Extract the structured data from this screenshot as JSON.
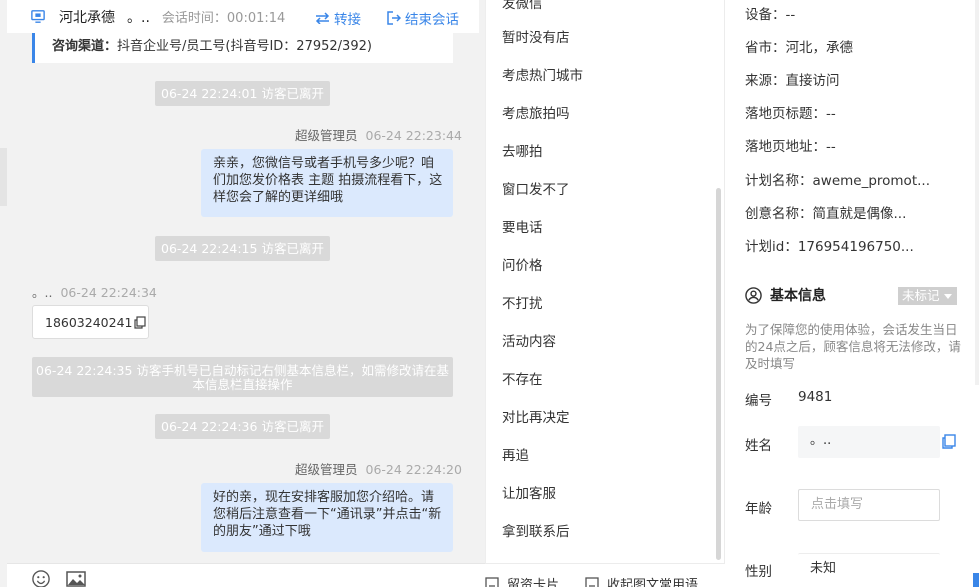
{
  "header": {
    "location": "河北承德",
    "visitor_name": "。..",
    "session_time": "会话时间：00:01:14",
    "transfer_label": "转接",
    "end_session_label": "结束会话"
  },
  "consult_channel": {
    "label": "咨询渠道：",
    "value": "抖音企业号/员工号(抖音号ID：27952/392)"
  },
  "messages": {
    "sys1": "06-24 22:24:01 访客已离开",
    "admin1_name": "超级管理员",
    "admin1_time": "06-24 22:23:44",
    "admin1_text": "亲亲，您微信号或者手机号多少呢？咱们加您发价格表 主题 拍摄流程看下，这样您会了解的更详细哦",
    "sys2": "06-24 22:24:15 访客已离开",
    "visitor_name": "。..",
    "visitor_time": "06-24 22:24:34",
    "visitor_phone": "18603240241",
    "sys3": "06-24 22:24:35 访客手机号已自动标记右侧基本信息栏，如需修改请在基本信息栏直接操作",
    "sys4": "06-24 22:24:36 访客已离开",
    "admin2_name": "超级管理员",
    "admin2_time": "06-24 22:24:20",
    "admin2_text": "好的亲，现在安排客服加您介绍哈。请您稍后注意查看一下“通讯录”并点击“新的朋友”通过下哦"
  },
  "quick_replies": {
    "items": [
      "发微信",
      "暂时没有店",
      "考虑热门城市",
      "考虑旅拍吗",
      "去哪拍",
      "窗口发不了",
      "要电话",
      "问价格",
      "不打扰",
      "活动内容",
      "不存在",
      "对比再决定",
      "再追",
      "让加客服",
      "拿到联系后"
    ],
    "card_label": "留资卡片",
    "fav_label": "收起图文常用语"
  },
  "visitor_info": {
    "device": "设备：--",
    "province_city": "省市：河北，承德",
    "source": "来源：直接访问",
    "landing_title": "落地页标题：--",
    "landing_url": "落地页地址：--",
    "plan_name": "计划名称：aweme_promot...",
    "creative_name": "创意名称：简直就是偶像...",
    "plan_id": "计划id：176954196750..."
  },
  "basic_info": {
    "section_title": "基本信息",
    "tag_label": "未标记",
    "notice": "为了保障您的使用体验，会话发生当日的24点之后，顾客信息将无法修改，请及时填写",
    "number_label": "编号",
    "number_value": "9481",
    "name_label": "姓名",
    "name_value": "。..",
    "age_label": "年龄",
    "age_placeholder": "点击填写",
    "gender_label": "性别",
    "gender_value": "未知"
  },
  "colors": {
    "accent": "#3a86e8",
    "bubble": "#dbe9fd",
    "system": "#d9d9d9"
  }
}
